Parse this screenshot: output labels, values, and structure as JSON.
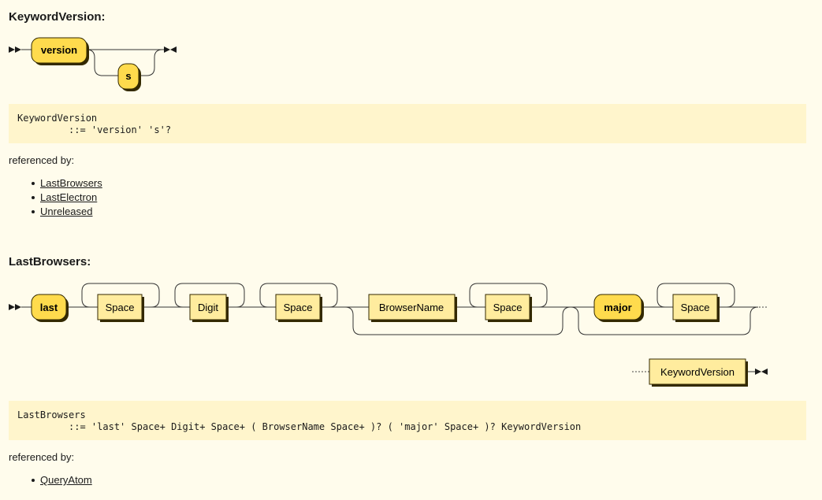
{
  "keyword_version": {
    "title": "KeywordVersion:",
    "diagram": {
      "terminal_version": "version",
      "terminal_s": "s"
    },
    "code_line1": "KeywordVersion",
    "code_line2": "         ::= 'version' 's'?",
    "referenced_by_label": "referenced by:",
    "references": [
      "LastBrowsers",
      "LastElectron",
      "Unreleased"
    ]
  },
  "last_browsers": {
    "title": "LastBrowsers:",
    "diagram": {
      "terminal_last": "last",
      "nonterm_space_1": "Space",
      "nonterm_digit": "Digit",
      "nonterm_space_2": "Space",
      "nonterm_browsername": "BrowserName",
      "nonterm_space_3": "Space",
      "terminal_major": "major",
      "nonterm_space_4": "Space",
      "nonterm_keywordversion": "KeywordVersion"
    },
    "code_line1": "LastBrowsers",
    "code_line2": "         ::= 'last' Space+ Digit+ Space+ ( BrowserName Space+ )? ( 'major' Space+ )? KeywordVersion",
    "referenced_by_label": "referenced by:",
    "references": [
      "QueryAtom"
    ]
  },
  "colors": {
    "background": "#fffcec",
    "code_background": "#fff5cc",
    "terminal_fill": "#ffdb4d",
    "nonterminal_fill": "#ffec9e",
    "line": "#333333",
    "shadow": "#332900"
  }
}
